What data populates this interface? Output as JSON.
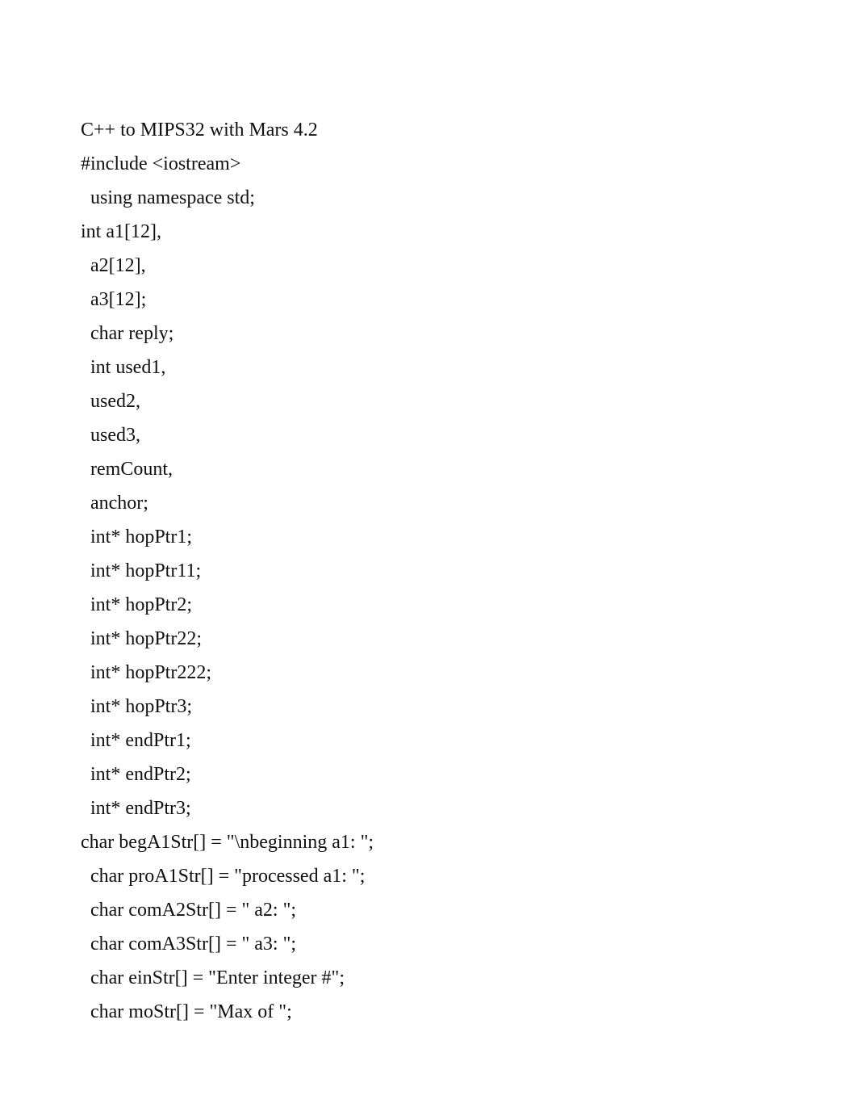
{
  "lines": [
    {
      "text": "C++ to MIPS32 with Mars 4.2",
      "indent": false
    },
    {
      "text": "#include <iostream>",
      "indent": false
    },
    {
      "text": "using namespace std;",
      "indent": true
    },
    {
      "text": "int a1[12],",
      "indent": false
    },
    {
      "text": "a2[12],",
      "indent": true
    },
    {
      "text": "a3[12];",
      "indent": true
    },
    {
      "text": "char reply;",
      "indent": true
    },
    {
      "text": "int used1,",
      "indent": true
    },
    {
      "text": "used2,",
      "indent": true
    },
    {
      "text": "used3,",
      "indent": true
    },
    {
      "text": "remCount,",
      "indent": true
    },
    {
      "text": "anchor;",
      "indent": true
    },
    {
      "text": "int* hopPtr1;",
      "indent": true
    },
    {
      "text": "int* hopPtr11;",
      "indent": true
    },
    {
      "text": "int* hopPtr2;",
      "indent": true
    },
    {
      "text": "int* hopPtr22;",
      "indent": true
    },
    {
      "text": "int* hopPtr222;",
      "indent": true
    },
    {
      "text": "int* hopPtr3;",
      "indent": true
    },
    {
      "text": "int* endPtr1;",
      "indent": true
    },
    {
      "text": "int* endPtr2;",
      "indent": true
    },
    {
      "text": "int* endPtr3;",
      "indent": true
    },
    {
      "text": "char begA1Str[] = \"\\nbeginning a1: \";",
      "indent": false
    },
    {
      "text": "char proA1Str[] = \"processed a1: \";",
      "indent": true
    },
    {
      "text": "char comA2Str[] = \" a2: \";",
      "indent": true
    },
    {
      "text": "char comA3Str[] = \" a3: \";",
      "indent": true
    },
    {
      "text": "char einStr[] = \"Enter integer #\";",
      "indent": true
    },
    {
      "text": "char moStr[] = \"Max of \";",
      "indent": true
    }
  ]
}
